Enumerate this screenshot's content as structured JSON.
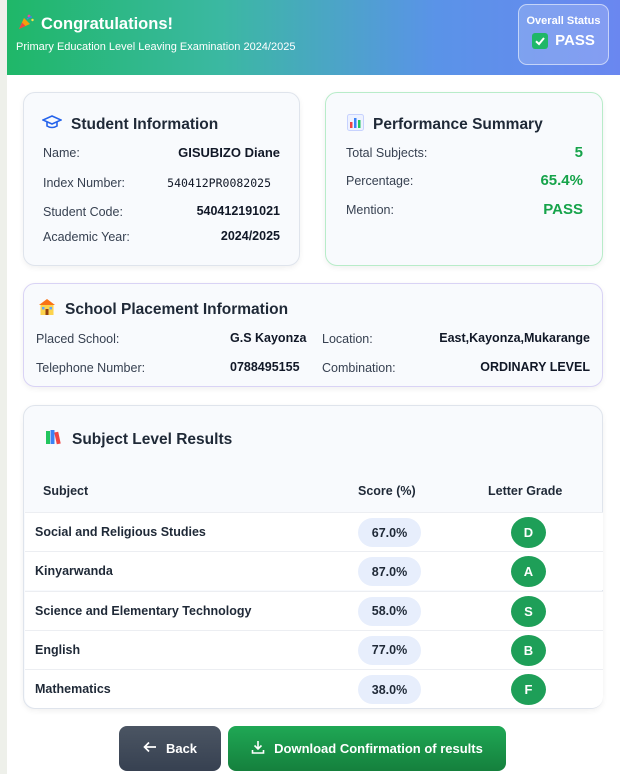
{
  "header": {
    "title": "Congratulations!",
    "subtitle": "Primary Education Level Leaving Examination 2024/2025",
    "status_label": "Overall Status",
    "status_value": "PASS"
  },
  "student": {
    "title": "Student Information",
    "name_label": "Name:",
    "name": "GISUBIZO Diane",
    "index_label": "Index Number:",
    "index": "540412PR0082025",
    "code_label": "Student Code:",
    "code": "540412191021",
    "year_label": "Academic Year:",
    "year": "2024/2025"
  },
  "performance": {
    "title": "Performance Summary",
    "subjects_label": "Total Subjects:",
    "subjects": "5",
    "percentage_label": "Percentage:",
    "percentage": "65.4%",
    "mention_label": "Mention:",
    "mention": "PASS"
  },
  "placement": {
    "title": "School Placement Information",
    "school_label": "Placed School:",
    "school": "G.S Kayonza",
    "location_label": "Location:",
    "location": "East,Kayonza,Mukarange",
    "phone_label": "Telephone Number:",
    "phone": "0788495155",
    "combination_label": "Combination:",
    "combination": "ORDINARY LEVEL"
  },
  "results": {
    "title": "Subject Level Results",
    "col_subject": "Subject",
    "col_score": "Score (%)",
    "col_grade": "Letter Grade",
    "rows": [
      {
        "subject": "Social and Religious Studies",
        "score": "67.0%",
        "grade": "D"
      },
      {
        "subject": "Kinyarwanda",
        "score": "87.0%",
        "grade": "A"
      },
      {
        "subject": "Science and Elementary Technology",
        "score": "58.0%",
        "grade": "S"
      },
      {
        "subject": "English",
        "score": "77.0%",
        "grade": "B"
      },
      {
        "subject": "Mathematics",
        "score": "38.0%",
        "grade": "F"
      }
    ]
  },
  "actions": {
    "back": "Back",
    "download": "Download Confirmation of results"
  },
  "colors": {
    "accent_green": "#16a34a",
    "grade_green": "#1e9f58",
    "back_button": "#3b4252",
    "download_button": "#16a34a"
  }
}
